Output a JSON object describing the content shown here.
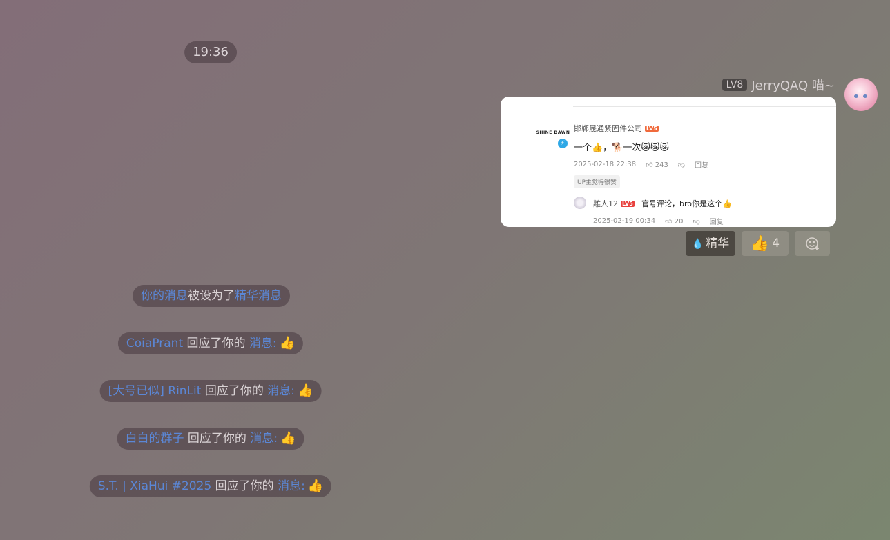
{
  "time": "19:36",
  "message": {
    "level": "LV8",
    "sender": "JerryQAQ 喵~",
    "card": {
      "logo_text": "SHINE DAWN",
      "username": "邯郸晟通紧固件公司",
      "user_level": "LV5",
      "comment": "一个👍，🐕一次😿😿😿",
      "date": "2025-02-18 22:38",
      "likes": "243",
      "reply_label": "回复",
      "up_tag": "UP主觉得很赞",
      "reply": {
        "username": "離人12",
        "user_level": "LV5",
        "text": "官号评论，bro你是这个👍",
        "date": "2025-02-19 00:34",
        "likes": "20",
        "reply_label": "回复"
      }
    },
    "reactions": {
      "essence_label": "精华",
      "like_emoji": "👍",
      "like_count": "4"
    }
  },
  "notifications": [
    {
      "link": "你的消息",
      "text": "被设为了",
      "link2": "精华消息"
    },
    {
      "user": "CoiaPrant",
      "text": " 回应了你的 ",
      "link": "消息:",
      "emoji": "👍"
    },
    {
      "user": "[大号已似] RinLit",
      "text": " 回应了你的 ",
      "link": "消息:",
      "emoji": "👍"
    },
    {
      "user": "白白的群子",
      "text": " 回应了你的 ",
      "link": "消息:",
      "emoji": "👍"
    },
    {
      "user": "S.T. | XiaHui #2025",
      "text": " 回应了你的 ",
      "link": "消息:",
      "emoji": "👍"
    }
  ],
  "colors": {
    "link": "#5b87d6",
    "essence_drop": "#f5b400",
    "level_badge": "#f06a3c"
  }
}
